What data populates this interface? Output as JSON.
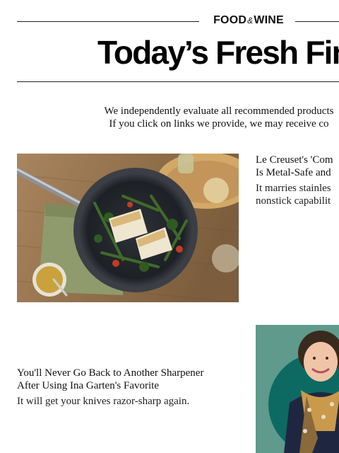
{
  "header": {
    "brand_left": "FOOD",
    "brand_amp": "&",
    "brand_right": "WINE",
    "headline": "Today’s Fresh Fin"
  },
  "disclosure": {
    "line1": "We independently evaluate all recommended products",
    "line2": "If you click on links we provide, we may receive co"
  },
  "articles": [
    {
      "title_line1": "Le Creuset's 'Com",
      "title_line2": "Is Metal-Safe and",
      "desc_line1": "It marries stainles",
      "desc_line2": "nonstick capabilit"
    },
    {
      "title_line1": "You'll Never Go Back to Another Sharpener",
      "title_line2": "After Using Ina Garten's Favorite",
      "desc_line1": "It will get your knives razor-sharp again."
    }
  ]
}
